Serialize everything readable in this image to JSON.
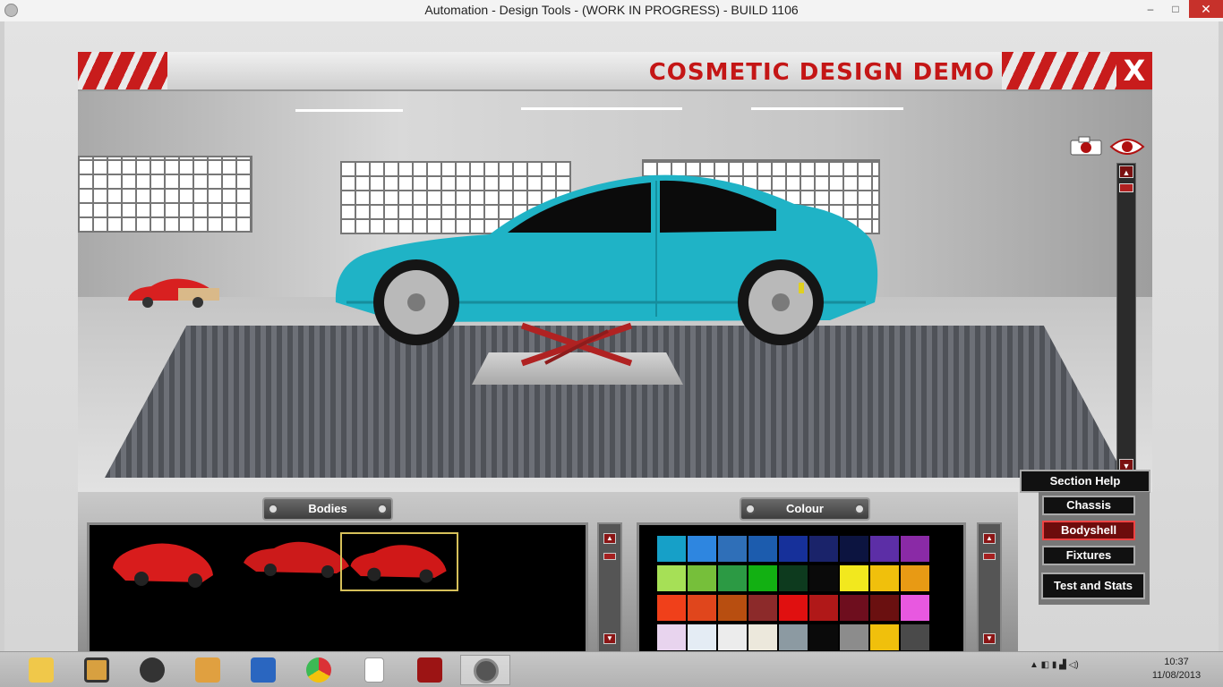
{
  "window": {
    "title": "Automation - Design Tools - (WORK IN PROGRESS) - BUILD 1106",
    "min_label": "–",
    "max_label": "□",
    "close_label": "✕"
  },
  "header": {
    "title": "COSMETIC DESIGN DEMO",
    "close_label": "X"
  },
  "bottom": {
    "bodies_label": "Bodies",
    "colour_label": "Colour",
    "bodies": [
      {
        "name": "hatchback",
        "color": "#d81c1c"
      },
      {
        "name": "sedan",
        "color": "#cc1a1a"
      },
      {
        "name": "coupe",
        "color": "#d01818",
        "selected": true
      }
    ],
    "palette": [
      [
        "#16a0c8",
        "#2e86e0",
        "#2f6fb8",
        "#1c5cae",
        "#16309a",
        "#1a236a",
        "#0c1440",
        "#5c2ea6",
        "#8a2aa6"
      ],
      [
        "#a6e056",
        "#76bf3a",
        "#2c9a44",
        "#12b012",
        "#0d3a1e",
        "#0a0a0a",
        "#f2e81e",
        "#f0c00c",
        "#e89a14"
      ],
      [
        "#f0401a",
        "#e0461c",
        "#b84e10",
        "#8c2a2a",
        "#e01010",
        "#b01818",
        "#6e0e1e",
        "#6a1010",
        "#e858e0"
      ],
      [
        "#e8d4ee",
        "#e4ecf4",
        "#ececec",
        "#ece8dc",
        "#8c9aa2",
        "#0a0a0a",
        "#8c8c8c",
        "#f0c00c",
        "#4a4a4a"
      ]
    ]
  },
  "side": {
    "section_help": "Section Help",
    "buttons": [
      "Chassis",
      "Bodyshell",
      "Fixtures"
    ],
    "active_button": "Bodyshell",
    "test_and_stats": "Test and Stats"
  },
  "taskbar": {
    "items": [
      "file-explorer",
      "settings-app",
      "audio-app",
      "doc-app",
      "control-panel",
      "chrome",
      "blank-document",
      "power-app",
      "automation-app"
    ],
    "active_item": "automation-app"
  },
  "clock": {
    "time": "10:37",
    "date": "11/08/2013"
  },
  "colors": {
    "car_body": "#1fb3c6",
    "accent_red": "#c41616"
  }
}
